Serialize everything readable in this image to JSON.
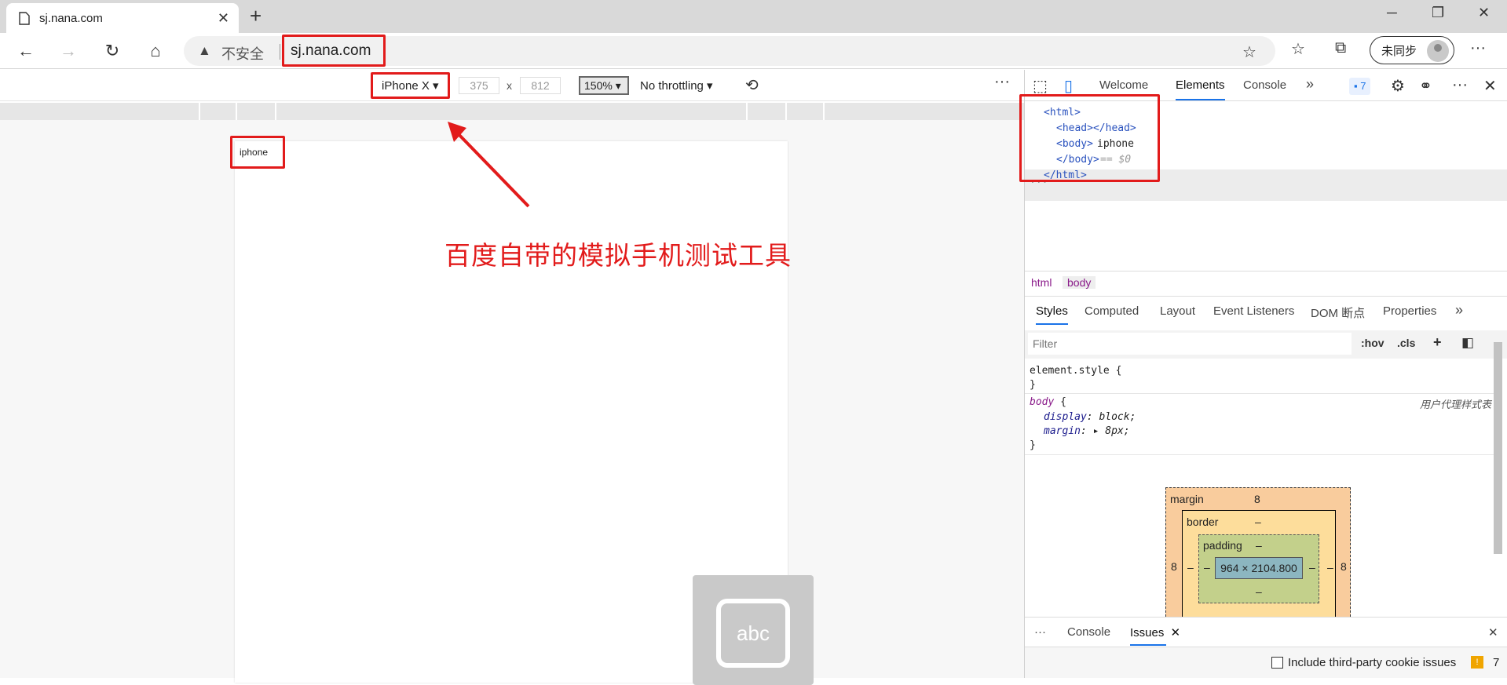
{
  "browser": {
    "tab_title": "sj.nana.com",
    "tab_close": "✕",
    "new_tab": "+",
    "win_min": "─",
    "win_max": "❐",
    "win_close": "✕"
  },
  "address": {
    "back": "←",
    "forward": "→",
    "reload": "↻",
    "home": "⌂",
    "warn_icon": "▲",
    "not_secure": "不安全",
    "url": "sj.nana.com",
    "favorite_icon": "☆",
    "favorites_icon": "☆",
    "collections_icon": "⧉",
    "profile_label": "未同步",
    "menu": "···"
  },
  "device_toolbar": {
    "device": "iPhone X ▾",
    "width": "375",
    "times": "x",
    "height": "812",
    "zoom": "150% ▾",
    "throttling": "No throttling ▾",
    "rotate": "⟲",
    "more": "···"
  },
  "page": {
    "body_text": "iphone",
    "annotation": "百度自带的模拟手机测试工具",
    "keyboard_label": "abc"
  },
  "devtools": {
    "inspect_icon": "⬚",
    "device_icon": "▯",
    "tabs": [
      "Welcome",
      "Elements",
      "Console"
    ],
    "more_tabs": "»",
    "issues_count": "7",
    "settings_icon": "⚙",
    "customize_icon": "⚭",
    "more": "···",
    "close": "✕",
    "dom": {
      "l1": "<html>",
      "l2": "<head></head>",
      "l3_tag": "<body>",
      "l3_text": "iphone",
      "l4_tag": "</body>",
      "l4_eq": " == $0",
      "l5": "</html>",
      "ellipsis": "···"
    },
    "breadcrumbs": [
      "html",
      "body"
    ],
    "style_tabs": [
      "Styles",
      "Computed",
      "Layout",
      "Event Listeners",
      "DOM 断点",
      "Properties"
    ],
    "style_more": "»",
    "filter_placeholder": "Filter",
    "hov": ":hov",
    "cls": ".cls",
    "plus": "+",
    "sidebar_toggle": "◧",
    "rules": {
      "r1_open": "element.style {",
      "r1_close": "}",
      "r2_selector": "body",
      "r2_brace": " {",
      "r2_origin": "用户代理样式表",
      "p1_name": "display",
      "p1_value": "block;",
      "p2_name": "margin",
      "p2_value": "8px;",
      "r2_close": "}"
    },
    "box_model": {
      "margin_label": "margin",
      "margin_top": "8",
      "margin_left": "8",
      "margin_right": "8",
      "border_label": "border",
      "border_dash": "–",
      "padding_label": "padding",
      "padding_dash": "–",
      "content": "964 × 2104.800"
    },
    "drawer": {
      "more": "···",
      "tabs": [
        "Console",
        "Issues"
      ],
      "close_tab": "✕",
      "close": "✕"
    },
    "issues_bar": {
      "include_label": "Include third-party cookie issues",
      "count": "7"
    }
  },
  "colors": {
    "highlight": "#e21b1b",
    "accent": "#1a73e8"
  }
}
